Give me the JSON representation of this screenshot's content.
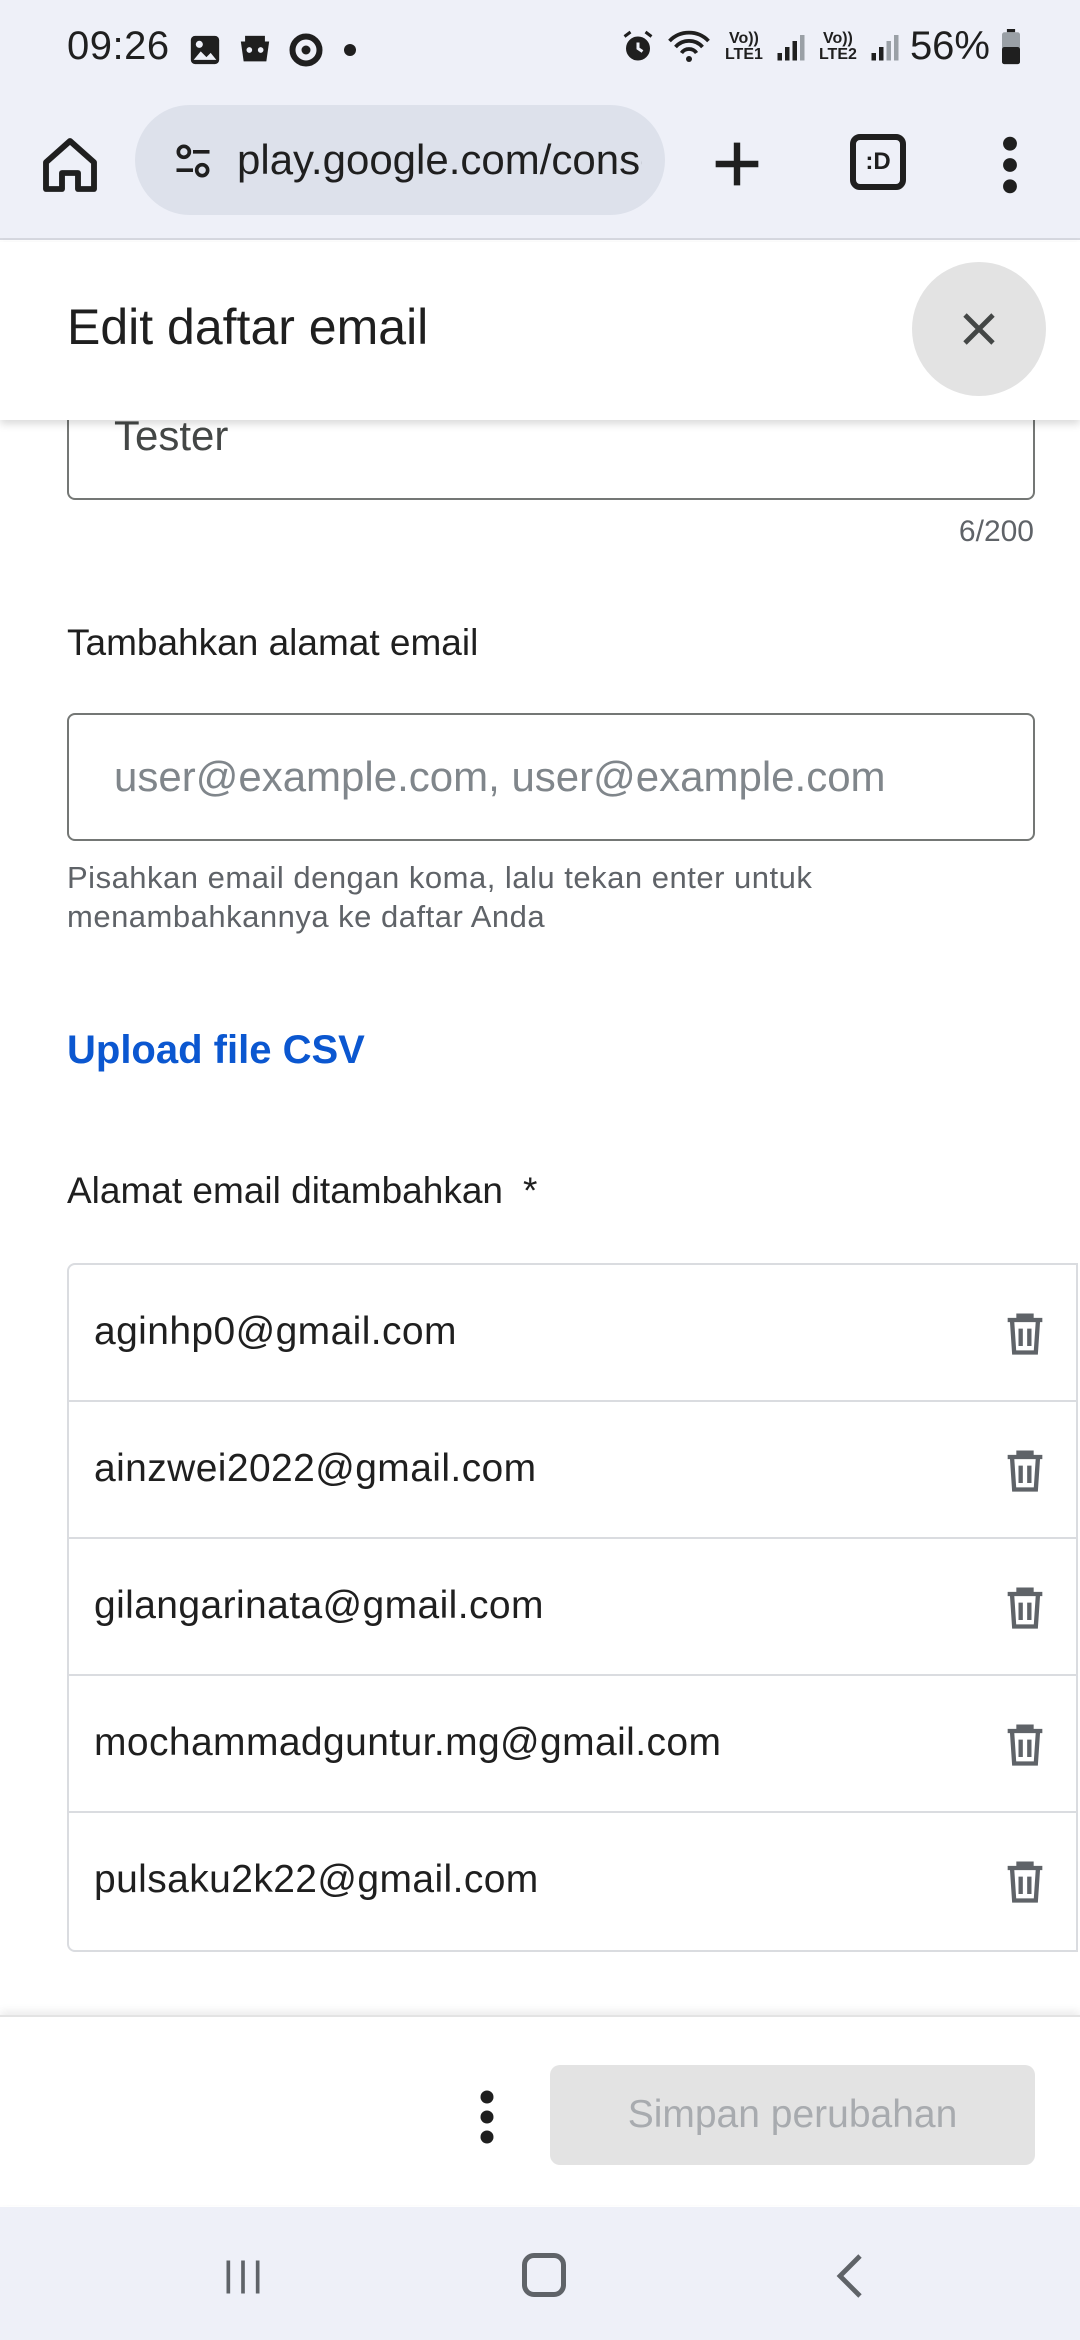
{
  "status_bar": {
    "time": "09:26",
    "battery": "56%",
    "lte1": "Vo)) LTE1",
    "lte2": "Vo)) LTE2",
    "icons": [
      "gallery-icon",
      "game-icon",
      "sync-icon",
      "dot-icon",
      "alarm-icon",
      "wifi-icon",
      "signal-icon",
      "battery-icon"
    ]
  },
  "browser": {
    "url": "play.google.com/console",
    "tabs_label": ":D"
  },
  "dialog": {
    "title": "Edit daftar email",
    "name_value": "Tester",
    "char_count": "6/200",
    "add_email_label": "Tambahkan alamat email",
    "email_placeholder": "user@example.com, user@example.com",
    "helper_text": "Pisahkan email dengan koma, lalu tekan enter untuk menambahkannya ke daftar Anda",
    "upload_link": "Upload file CSV",
    "added_label": "Alamat email ditambahkan",
    "required_marker": "*",
    "emails": [
      "aginhp0@gmail.com",
      "ainzwei2022@gmail.com",
      "gilangarinata@gmail.com",
      "mochammadguntur.mg@gmail.com",
      "pulsaku2k22@gmail.com"
    ],
    "save_label": "Simpan perubahan"
  }
}
